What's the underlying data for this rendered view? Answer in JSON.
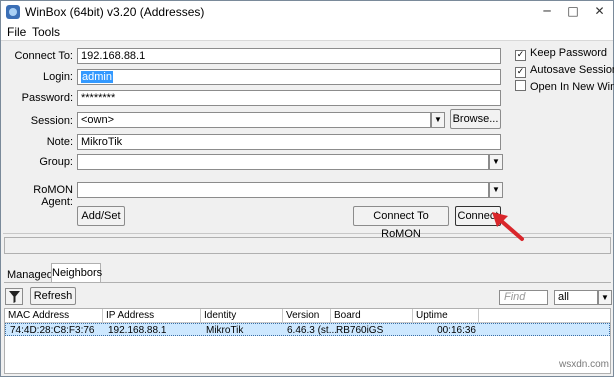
{
  "window": {
    "title": "WinBox (64bit) v3.20 (Addresses)"
  },
  "title_buttons": {
    "minimize": "─",
    "maximize": "□",
    "close": "✕"
  },
  "menu": {
    "file": "File",
    "tools": "Tools"
  },
  "connect": {
    "connect_to_label": "Connect To:",
    "connect_to_value": "192.168.88.1",
    "login_label": "Login:",
    "login_value": "admin",
    "password_label": "Password:",
    "password_value": "********",
    "session_label": "Session:",
    "session_value": "<own>",
    "browse_label": "Browse...",
    "note_label": "Note:",
    "note_value": "MikroTik",
    "group_label": "Group:",
    "group_value": "",
    "romon_label": "RoMON Agent:",
    "romon_value": "",
    "addset_label": "Add/Set",
    "connect_romon_label": "Connect To RoMON",
    "connect_label": "Connect"
  },
  "options": {
    "keep_password": {
      "label": "Keep Password",
      "checked": true
    },
    "autosave_session": {
      "label": "Autosave Session",
      "checked": true
    },
    "open_new_window": {
      "label": "Open In New Window",
      "checked": false
    }
  },
  "check_glyph": "✓",
  "dropdown_glyph": "▼",
  "tabs": {
    "managed": "Managed",
    "neighbors": "Neighbors"
  },
  "neighbors": {
    "refresh_label": "Refresh",
    "find_placeholder": "Find",
    "filter_value": "all",
    "columns": [
      "MAC Address",
      "IP Address",
      "Identity",
      "Version",
      "Board",
      "Uptime"
    ],
    "rows": [
      [
        "74:4D:28:C8:F3:76",
        "192.168.88.1",
        "MikroTik",
        "6.46.3 (st...",
        "RB760iGS",
        "00:16:36"
      ]
    ]
  },
  "watermark": "wsxdn.com",
  "colors": {
    "selection": "#3399ff",
    "row_highlight": "#cde8ff",
    "arrow": "#d9262b"
  }
}
